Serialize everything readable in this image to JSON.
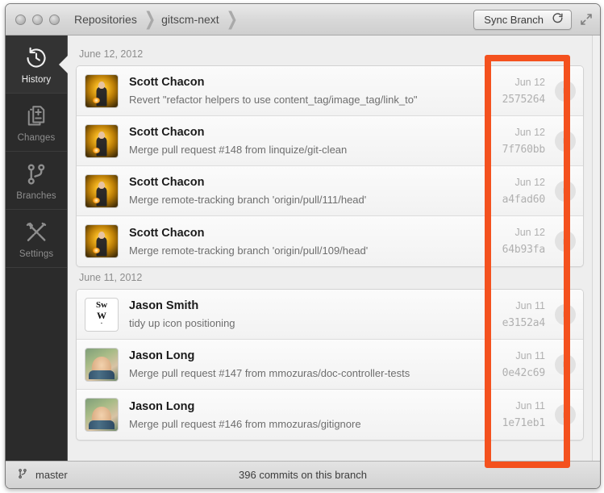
{
  "window": {
    "traffic_lights": [
      "close",
      "minimize",
      "zoom"
    ],
    "breadcrumbs": [
      {
        "label": "Repositories"
      },
      {
        "label": "gitscm-next"
      }
    ],
    "breadcrumb_separator": "❯",
    "sync_button_label": "Sync Branch",
    "sync_icon": "refresh-icon",
    "fullscreen_icon": "fullscreen-icon"
  },
  "sidebar": {
    "items": [
      {
        "label": "History",
        "icon": "history-clock-icon",
        "active": true
      },
      {
        "label": "Changes",
        "icon": "changes-document-icon",
        "active": false
      },
      {
        "label": "Branches",
        "icon": "branch-fork-icon",
        "active": false
      },
      {
        "label": "Settings",
        "icon": "wrench-screwdriver-icon",
        "active": false
      }
    ]
  },
  "history": {
    "groups": [
      {
        "date_label": "June 12, 2012",
        "commits": [
          {
            "author": "Scott Chacon",
            "avatar": "scott-chacon-avatar",
            "message": "Revert \"refactor helpers to use content_tag/image_tag/link_to\"",
            "date": "Jun 12",
            "sha": "2575264"
          },
          {
            "author": "Scott Chacon",
            "avatar": "scott-chacon-avatar",
            "message": "Merge pull request #148 from linquize/git-clean",
            "date": "Jun 12",
            "sha": "7f760bb"
          },
          {
            "author": "Scott Chacon",
            "avatar": "scott-chacon-avatar",
            "message": "Merge remote-tracking branch 'origin/pull/111/head'",
            "date": "Jun 12",
            "sha": "a4fad60"
          },
          {
            "author": "Scott Chacon",
            "avatar": "scott-chacon-avatar",
            "message": "Merge remote-tracking branch 'origin/pull/109/head'",
            "date": "Jun 12",
            "sha": "64b93fa"
          }
        ]
      },
      {
        "date_label": "June 11, 2012",
        "commits": [
          {
            "author": "Jason Smith",
            "avatar": "jason-smith-avatar",
            "message": "tidy up icon positioning",
            "date": "Jun 11",
            "sha": "e3152a4"
          },
          {
            "author": "Jason Long",
            "avatar": "jason-long-avatar",
            "message": "Merge pull request #147 from mmozuras/doc-controller-tests",
            "date": "Jun 11",
            "sha": "0e42c69"
          },
          {
            "author": "Jason Long",
            "avatar": "jason-long-avatar",
            "message": "Merge pull request #146 from mmozuras/gitignore",
            "date": "Jun 11",
            "sha": "1e71eb1"
          }
        ]
      }
    ]
  },
  "avatars": {
    "jason_smith_monogram": {
      "line1": "Sw",
      "line2": "W",
      "line3": "·"
    }
  },
  "footer": {
    "branch_icon": "branch-fork-icon",
    "branch_name": "master",
    "commit_count_text": "396 commits on this branch"
  },
  "annotation": {
    "color": "#f4511e",
    "name": "commit-metadata-highlight"
  }
}
